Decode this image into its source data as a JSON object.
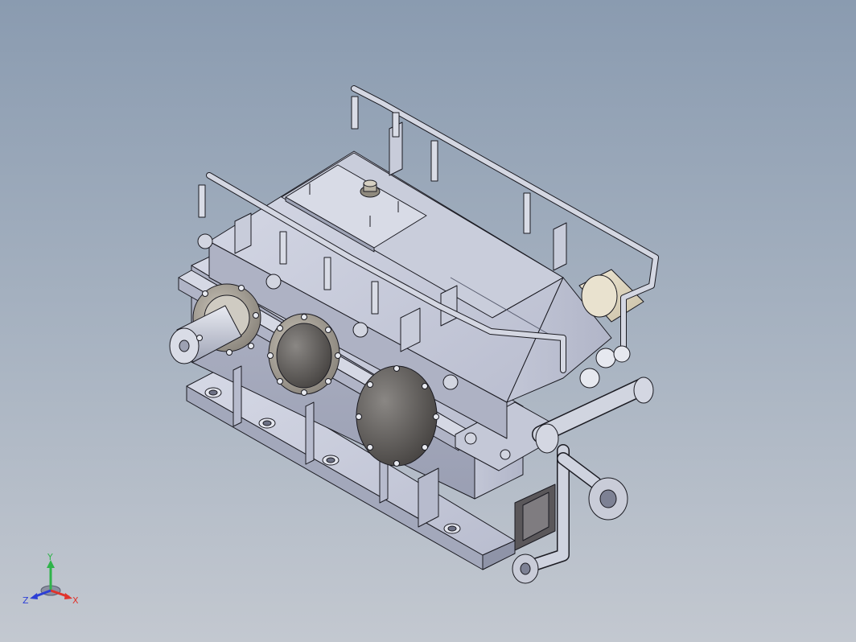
{
  "view": {
    "background_top": "#8a9bb0",
    "background_bottom": "#c3c8d0",
    "model": "gearbox-assembly",
    "part_color": "#c6cad8",
    "pipe_color": "#cfd3df",
    "edge_color": "#1b1b22"
  },
  "triad": {
    "x_label": "X",
    "y_label": "Y",
    "z_label": "Z",
    "x_color": "#e0342c",
    "y_color": "#2fb34a",
    "z_color": "#2d3fd6"
  }
}
